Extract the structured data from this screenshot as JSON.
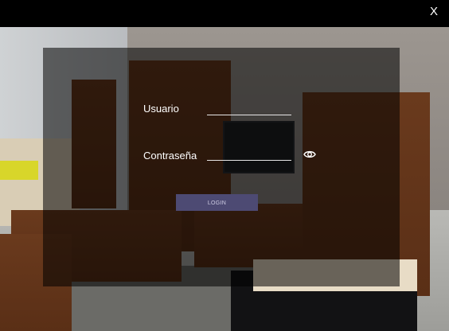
{
  "window": {
    "close_label": "X"
  },
  "form": {
    "username_label": "Usuario",
    "username_value": "",
    "password_label": "Contraseña",
    "password_value": "",
    "login_label": "LOGIN"
  },
  "icons": {
    "close": "close-icon",
    "visibility": "eye-icon"
  },
  "colors": {
    "panel_overlay": "#000000",
    "login_button": "#4d4a73",
    "text": "#ffffff"
  }
}
